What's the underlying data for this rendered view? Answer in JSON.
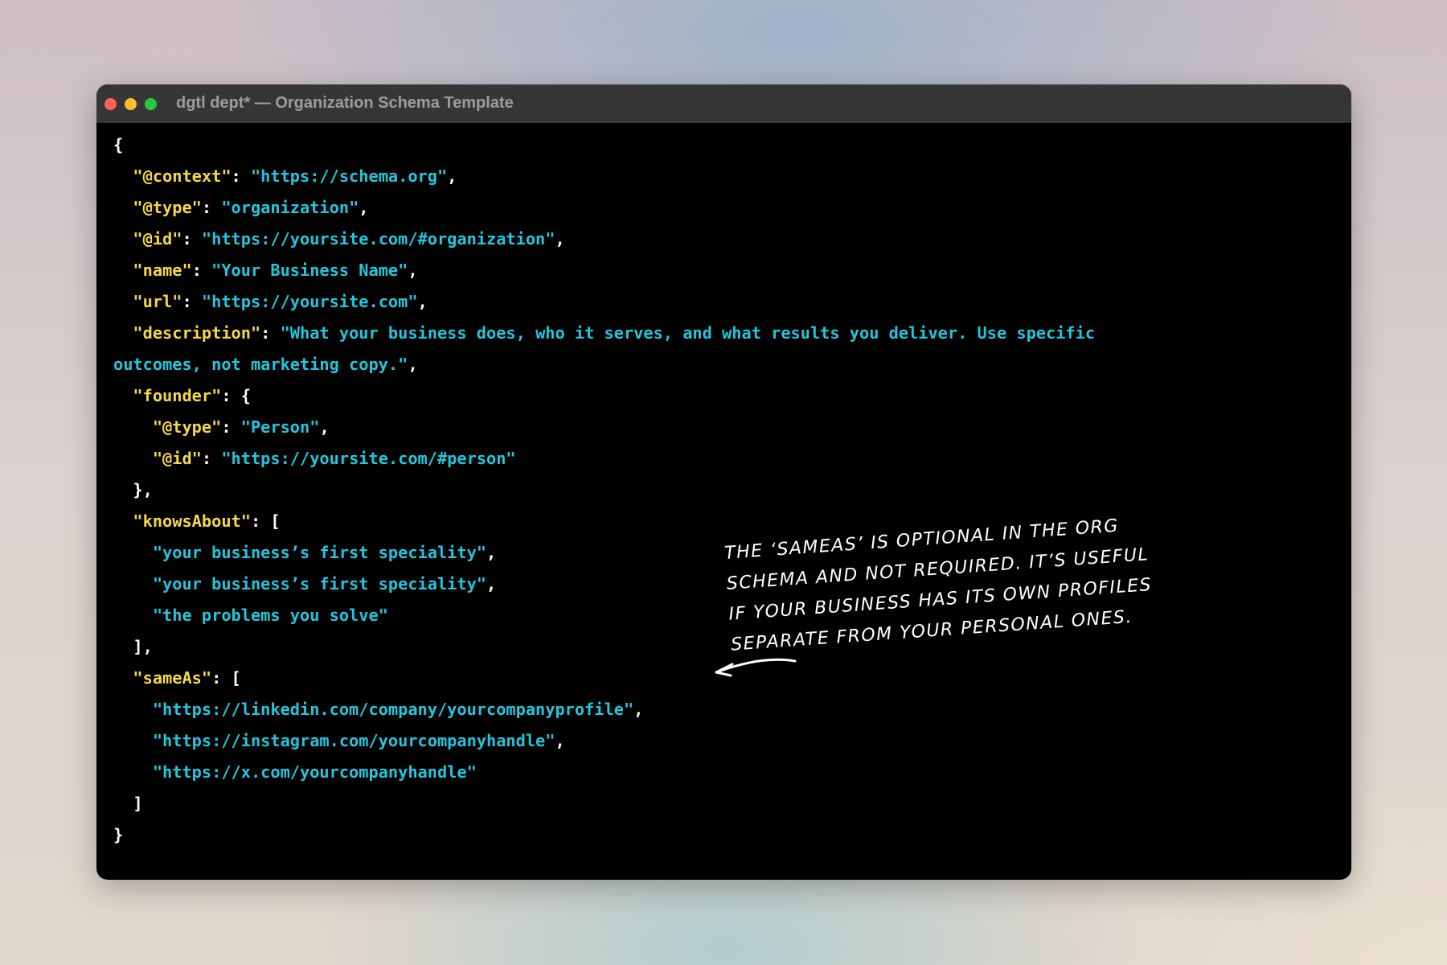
{
  "window": {
    "title": "dgtl dept* — Organization Schema Template",
    "traffic_lights": [
      {
        "name": "close",
        "color": "#fe5f57"
      },
      {
        "name": "minimize",
        "color": "#febc2e"
      },
      {
        "name": "zoom",
        "color": "#28c840"
      }
    ]
  },
  "colors": {
    "key": "#f5d84a",
    "string": "#22c6dd",
    "punctuation": "#ffffff",
    "background": "#000000",
    "titlebar": "#363637"
  },
  "code": {
    "lines": [
      [
        {
          "t": "p",
          "v": "{"
        }
      ],
      [
        {
          "t": "p",
          "v": "  "
        },
        {
          "t": "k",
          "v": "\"@context\""
        },
        {
          "t": "p",
          "v": ": "
        },
        {
          "t": "s",
          "v": "\"https://schema.org\""
        },
        {
          "t": "p",
          "v": ","
        }
      ],
      [
        {
          "t": "p",
          "v": "  "
        },
        {
          "t": "k",
          "v": "\"@type\""
        },
        {
          "t": "p",
          "v": ": "
        },
        {
          "t": "s",
          "v": "\"organization\""
        },
        {
          "t": "p",
          "v": ","
        }
      ],
      [
        {
          "t": "p",
          "v": "  "
        },
        {
          "t": "k",
          "v": "\"@id\""
        },
        {
          "t": "p",
          "v": ": "
        },
        {
          "t": "s",
          "v": "\"https://yoursite.com/#organization\""
        },
        {
          "t": "p",
          "v": ","
        }
      ],
      [
        {
          "t": "p",
          "v": "  "
        },
        {
          "t": "k",
          "v": "\"name\""
        },
        {
          "t": "p",
          "v": ": "
        },
        {
          "t": "s",
          "v": "\"Your Business Name\""
        },
        {
          "t": "p",
          "v": ","
        }
      ],
      [
        {
          "t": "p",
          "v": "  "
        },
        {
          "t": "k",
          "v": "\"url\""
        },
        {
          "t": "p",
          "v": ": "
        },
        {
          "t": "s",
          "v": "\"https://yoursite.com\""
        },
        {
          "t": "p",
          "v": ","
        }
      ],
      [
        {
          "t": "p",
          "v": "  "
        },
        {
          "t": "k",
          "v": "\"description\""
        },
        {
          "t": "p",
          "v": ": "
        },
        {
          "t": "s",
          "v": "\"What your business does, who it serves, and what results you deliver. Use specific"
        }
      ],
      [
        {
          "t": "s",
          "v": "outcomes, not marketing copy.\""
        },
        {
          "t": "p",
          "v": ","
        }
      ],
      [
        {
          "t": "p",
          "v": "  "
        },
        {
          "t": "k",
          "v": "\"founder\""
        },
        {
          "t": "p",
          "v": ": {"
        }
      ],
      [
        {
          "t": "p",
          "v": "    "
        },
        {
          "t": "k",
          "v": "\"@type\""
        },
        {
          "t": "p",
          "v": ": "
        },
        {
          "t": "s",
          "v": "\"Person\""
        },
        {
          "t": "p",
          "v": ","
        }
      ],
      [
        {
          "t": "p",
          "v": "    "
        },
        {
          "t": "k",
          "v": "\"@id\""
        },
        {
          "t": "p",
          "v": ": "
        },
        {
          "t": "s",
          "v": "\"https://yoursite.com/#person\""
        }
      ],
      [
        {
          "t": "p",
          "v": "  },"
        }
      ],
      [
        {
          "t": "p",
          "v": "  "
        },
        {
          "t": "k",
          "v": "\"knowsAbout\""
        },
        {
          "t": "p",
          "v": ": ["
        }
      ],
      [
        {
          "t": "p",
          "v": "    "
        },
        {
          "t": "s",
          "v": "\"your business’s first speciality\""
        },
        {
          "t": "p",
          "v": ","
        }
      ],
      [
        {
          "t": "p",
          "v": "    "
        },
        {
          "t": "s",
          "v": "\"your business’s first speciality\""
        },
        {
          "t": "p",
          "v": ","
        }
      ],
      [
        {
          "t": "p",
          "v": "    "
        },
        {
          "t": "s",
          "v": "\"the problems you solve\""
        }
      ],
      [
        {
          "t": "p",
          "v": "  ],"
        }
      ],
      [
        {
          "t": "p",
          "v": "  "
        },
        {
          "t": "k",
          "v": "\"sameAs\""
        },
        {
          "t": "p",
          "v": ": ["
        }
      ],
      [
        {
          "t": "p",
          "v": "    "
        },
        {
          "t": "s",
          "v": "\"https://linkedin.com/company/yourcompanyprofile\""
        },
        {
          "t": "p",
          "v": ","
        }
      ],
      [
        {
          "t": "p",
          "v": "    "
        },
        {
          "t": "s",
          "v": "\"https://instagram.com/yourcompanyhandle\""
        },
        {
          "t": "p",
          "v": ","
        }
      ],
      [
        {
          "t": "p",
          "v": "    "
        },
        {
          "t": "s",
          "v": "\"https://x.com/yourcompanyhandle\""
        }
      ],
      [
        {
          "t": "p",
          "v": "  ]"
        }
      ],
      [
        {
          "t": "p",
          "v": "}"
        }
      ]
    ]
  },
  "annotation": {
    "lines": [
      "The ‘sameAs’ is optional in the org",
      "schema and not required. It’s useful",
      "if your business has its own profiles",
      "separate from your personal ones."
    ],
    "arrow_icon": "hand-drawn-arrow-left"
  }
}
